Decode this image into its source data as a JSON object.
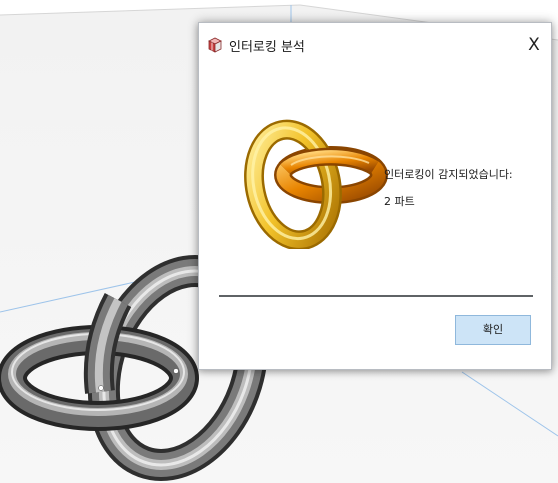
{
  "dialog": {
    "title": "인터로킹 분석",
    "close_label": "X",
    "message": "인터로킹이 감지되었습니다:",
    "part_count": "2 파트",
    "ok_label": "확인"
  },
  "icons": {
    "title_icon": "box-icon",
    "illustration": "interlocked-rings-icon"
  },
  "colors": {
    "ok_button_bg": "#cde4f7",
    "ok_button_border": "#8fb8dc",
    "gold_ring": "#f0b820",
    "orange_ring": "#e07a00",
    "gray_ring": "#7d7d7d"
  }
}
